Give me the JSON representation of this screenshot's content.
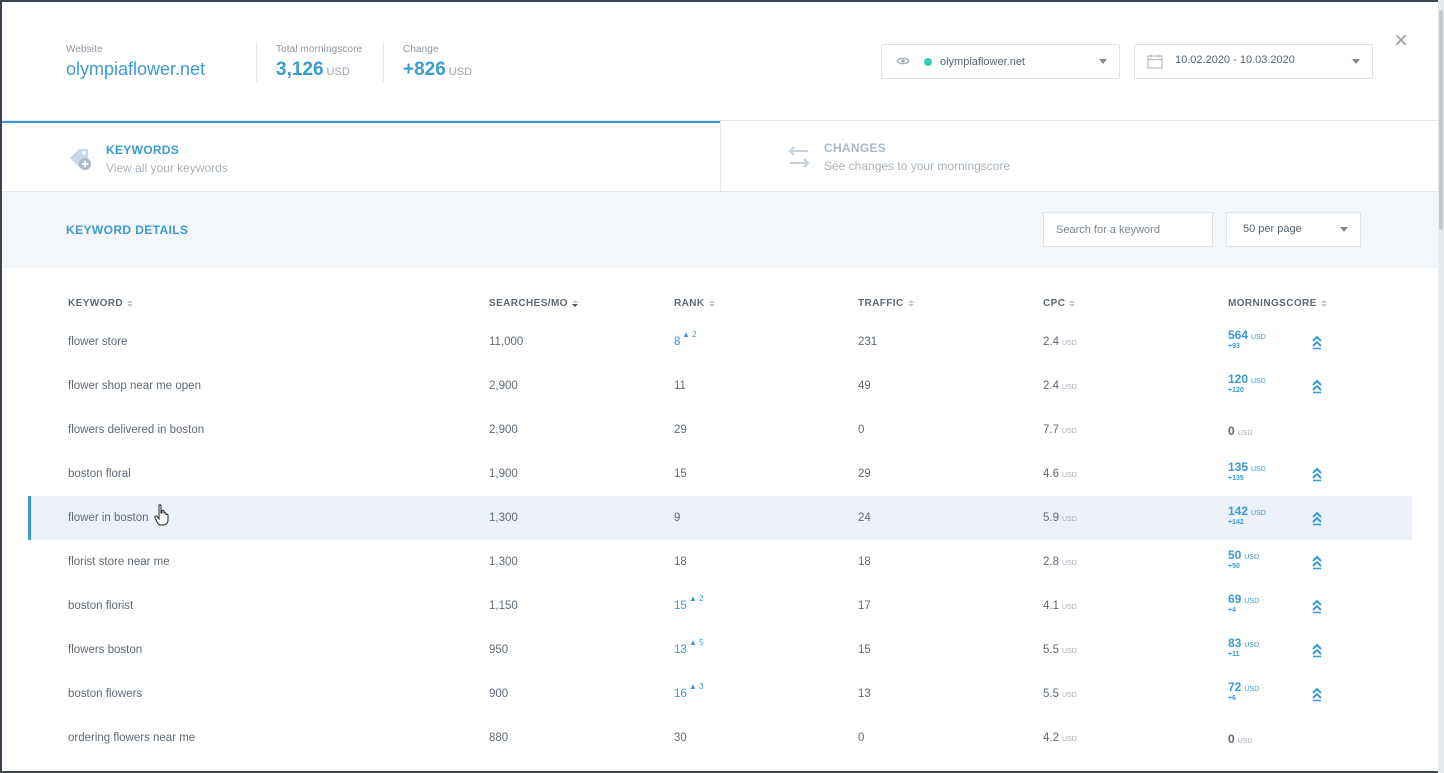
{
  "header": {
    "website_label": "Website",
    "website": "olympiaflower.net",
    "total_label": "Total morningscore",
    "total_value": "3,126",
    "total_unit": "USD",
    "change_label": "Change",
    "change_value": "+826",
    "change_unit": "USD",
    "site_select": "olympiaflower.net",
    "date_range": "10.02.2020 - 10.03.2020",
    "close": "×"
  },
  "tabs": [
    {
      "title": "KEYWORDS",
      "subtitle": "View all your keywords"
    },
    {
      "title": "CHANGES",
      "subtitle": "See changes to your morningscore"
    }
  ],
  "details": {
    "title": "KEYWORD DETAILS",
    "search_placeholder": "Search for a keyword",
    "per_page": "50 per page"
  },
  "table": {
    "columns": [
      "KEYWORD",
      "SEARCHES/MO",
      "RANK",
      "TRAFFIC",
      "CPC",
      "MORNINGSCORE"
    ],
    "unit": "USD",
    "rows": [
      {
        "keyword": "flower store",
        "searches": "11,000",
        "rank": "8",
        "rank_delta": "▲ 2",
        "traffic": "231",
        "cpc": "2.4",
        "ms": "564",
        "ms_delta": "+93"
      },
      {
        "keyword": "flower shop near me open",
        "searches": "2,900",
        "rank": "11",
        "rank_delta": "",
        "traffic": "49",
        "cpc": "2.4",
        "ms": "120",
        "ms_delta": "+120"
      },
      {
        "keyword": "flowers delivered in boston",
        "searches": "2,900",
        "rank": "29",
        "rank_delta": "",
        "traffic": "0",
        "cpc": "7.7",
        "ms": "0",
        "ms_delta": ""
      },
      {
        "keyword": "boston floral",
        "searches": "1,900",
        "rank": "15",
        "rank_delta": "",
        "traffic": "29",
        "cpc": "4.6",
        "ms": "135",
        "ms_delta": "+135"
      },
      {
        "keyword": "flower in boston",
        "searches": "1,300",
        "rank": "9",
        "rank_delta": "",
        "traffic": "24",
        "cpc": "5.9",
        "ms": "142",
        "ms_delta": "+142"
      },
      {
        "keyword": "florist store near me",
        "searches": "1,300",
        "rank": "18",
        "rank_delta": "",
        "traffic": "18",
        "cpc": "2.8",
        "ms": "50",
        "ms_delta": "+50"
      },
      {
        "keyword": "boston florist",
        "searches": "1,150",
        "rank": "15",
        "rank_delta": "▲ 2",
        "traffic": "17",
        "cpc": "4.1",
        "ms": "69",
        "ms_delta": "+4"
      },
      {
        "keyword": "flowers boston",
        "searches": "950",
        "rank": "13",
        "rank_delta": "▲ 5",
        "traffic": "15",
        "cpc": "5.5",
        "ms": "83",
        "ms_delta": "+11"
      },
      {
        "keyword": "boston flowers",
        "searches": "900",
        "rank": "16",
        "rank_delta": "▲ 3",
        "traffic": "13",
        "cpc": "5.5",
        "ms": "72",
        "ms_delta": "+6"
      },
      {
        "keyword": "ordering flowers near me",
        "searches": "880",
        "rank": "30",
        "rank_delta": "",
        "traffic": "0",
        "cpc": "4.2",
        "ms": "0",
        "ms_delta": ""
      }
    ]
  },
  "colors": {
    "accent": "#3a9bd1",
    "online_dot": "#2bd3b3",
    "highlight_row": "#edf2fa"
  }
}
